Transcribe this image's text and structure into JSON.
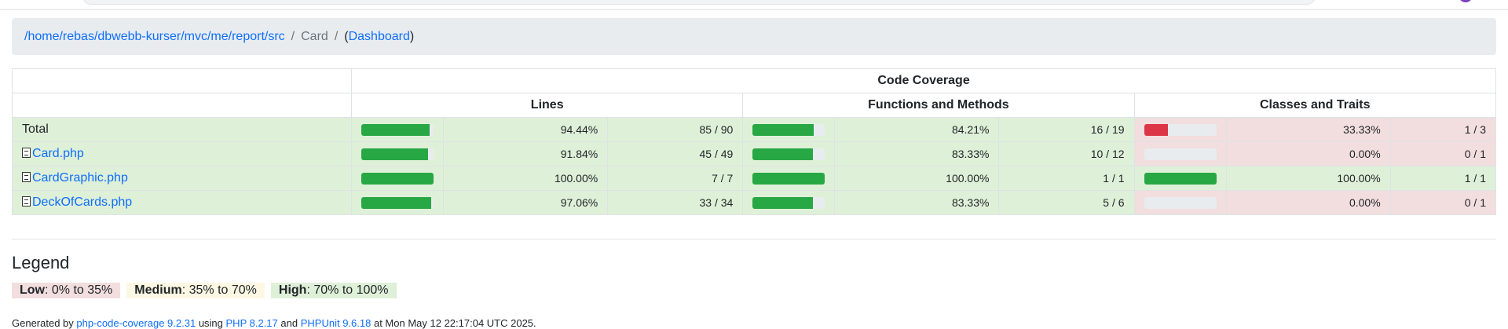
{
  "breadcrumb": {
    "path": "/home/rebas/dbwebb-kurser/mvc/me/report/src",
    "separator": "/",
    "current": "Card",
    "open_paren": "(",
    "dashboard": "Dashboard",
    "close_paren": ")"
  },
  "table": {
    "group_header": "Code Coverage",
    "headers": {
      "lines": "Lines",
      "functions": "Functions and Methods",
      "classes": "Classes and Traits"
    },
    "rows": [
      {
        "name": "Total",
        "lines_pct": "94.44%",
        "lines_ratio": "85 / 90",
        "lines_fill": 94.44,
        "func_pct": "84.21%",
        "func_ratio": "16 / 19",
        "func_fill": 84.21,
        "class_pct": "33.33%",
        "class_ratio": "1 / 3",
        "class_fill": 33.33,
        "class_level": "low"
      },
      {
        "name": "Card.php",
        "lines_pct": "91.84%",
        "lines_ratio": "45 / 49",
        "lines_fill": 91.84,
        "func_pct": "83.33%",
        "func_ratio": "10 / 12",
        "func_fill": 83.33,
        "class_pct": "0.00%",
        "class_ratio": "0 / 1",
        "class_fill": 0,
        "class_level": "low"
      },
      {
        "name": "CardGraphic.php",
        "lines_pct": "100.00%",
        "lines_ratio": "7 / 7",
        "lines_fill": 100,
        "func_pct": "100.00%",
        "func_ratio": "1 / 1",
        "func_fill": 100,
        "class_pct": "100.00%",
        "class_ratio": "1 / 1",
        "class_fill": 100,
        "class_level": "high"
      },
      {
        "name": "DeckOfCards.php",
        "lines_pct": "97.06%",
        "lines_ratio": "33 / 34",
        "lines_fill": 97.06,
        "func_pct": "83.33%",
        "func_ratio": "5 / 6",
        "func_fill": 83.33,
        "class_pct": "0.00%",
        "class_ratio": "0 / 1",
        "class_fill": 0,
        "class_level": "low"
      }
    ]
  },
  "legend": {
    "title": "Legend",
    "low_label": "Low",
    "low_range": ": 0% to 35%",
    "medium_label": "Medium",
    "medium_range": ": 35% to 70%",
    "high_label": "High",
    "high_range": ": 70% to 100%"
  },
  "footer": {
    "generated_by": "Generated by",
    "tool": "php-code-coverage 9.2.31",
    "using": "using",
    "php": "PHP 8.2.17",
    "and": "and",
    "phpunit": "PHPUnit 9.6.18",
    "date": "at Mon May 12 22:17:04 UTC 2025."
  },
  "colors": {
    "high_bg": "#dff0d8",
    "low_bg": "#f2dede",
    "medium_bg": "#fcf8e3",
    "bar_green": "#28a745",
    "bar_red": "#dc3545",
    "link": "#0d6efd"
  }
}
